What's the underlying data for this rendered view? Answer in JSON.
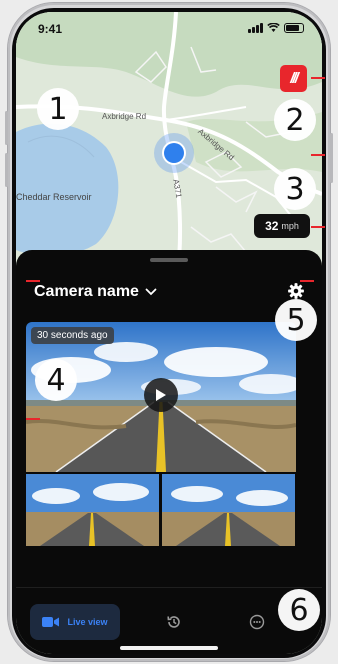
{
  "status_bar": {
    "time": "9:41"
  },
  "map": {
    "labels": [
      {
        "text": "Axbridge Rd"
      },
      {
        "text": "Axbridge Rd"
      },
      {
        "text": "A371"
      },
      {
        "text": "Cheddar Reservoir"
      }
    ],
    "brand_badge": "///",
    "speed": {
      "value": "32",
      "unit": "mph"
    }
  },
  "panel": {
    "camera_name": "Camera name",
    "video": {
      "timestamp": "30 seconds ago"
    }
  },
  "nav": {
    "live_view_label": "Live view"
  },
  "callouts": [
    "1",
    "2",
    "3",
    "4",
    "5",
    "6"
  ],
  "colors": {
    "brand_red": "#e8262c",
    "accent_blue": "#3b82f6",
    "panel_bg": "#0a0a0a",
    "map_water": "#a8cbe8",
    "map_green": "#c9dcc0"
  },
  "icons": {
    "camera": "camera-icon",
    "gear": "gear-icon",
    "play": "play-icon",
    "history": "history-icon",
    "more": "more-icon",
    "chevron": "chevron-down-icon",
    "location": "location-dot-icon"
  }
}
